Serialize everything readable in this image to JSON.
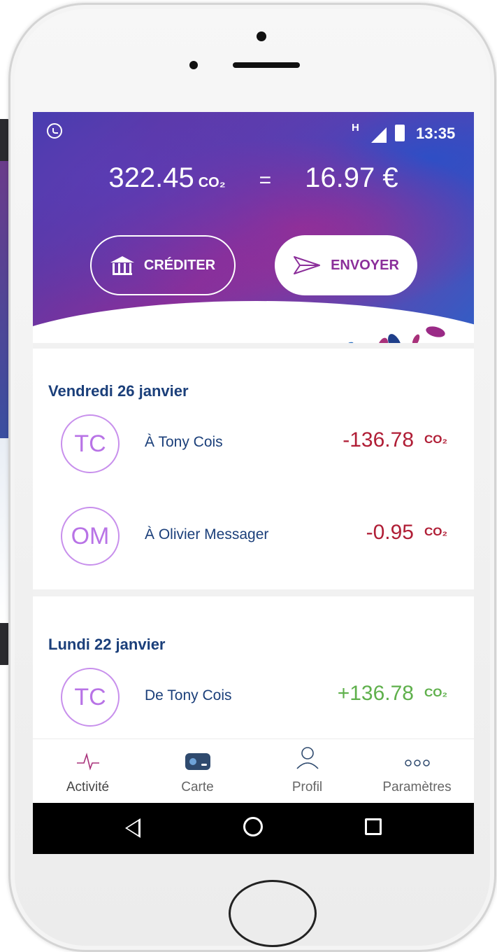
{
  "status_bar": {
    "network": "H",
    "time": "13:35"
  },
  "balance": {
    "co2_amount": "322.45",
    "co2_unit": "CO₂",
    "equals": "=",
    "euro_amount": "16.97 €"
  },
  "actions": {
    "credit_label": "CRÉDITER",
    "send_label": "ENVOYER"
  },
  "sections": [
    {
      "date": "Vendredi 26 janvier",
      "transactions": [
        {
          "initials": "TC",
          "name": "À Tony Cois",
          "amount": "-136.78",
          "unit": "CO₂"
        },
        {
          "initials": "OM",
          "name": "À Olivier Messager",
          "amount": "-0.95",
          "unit": "CO₂"
        }
      ]
    },
    {
      "date": "Lundi 22 janvier",
      "transactions": [
        {
          "initials": "TC",
          "name": "De Tony Cois",
          "amount": "+136.78",
          "unit": "CO₂"
        }
      ]
    }
  ],
  "tabs": [
    {
      "label": "Activité",
      "icon": "activity-icon"
    },
    {
      "label": "Carte",
      "icon": "card-icon"
    },
    {
      "label": "Profil",
      "icon": "profile-icon"
    },
    {
      "label": "Paramètres",
      "icon": "more-icon"
    }
  ],
  "colors": {
    "primary_text": "#1b3f7a",
    "negative": "#b01e36",
    "positive": "#5fb04c",
    "avatar": "#b873e6",
    "accent": "#8b2f9a"
  }
}
